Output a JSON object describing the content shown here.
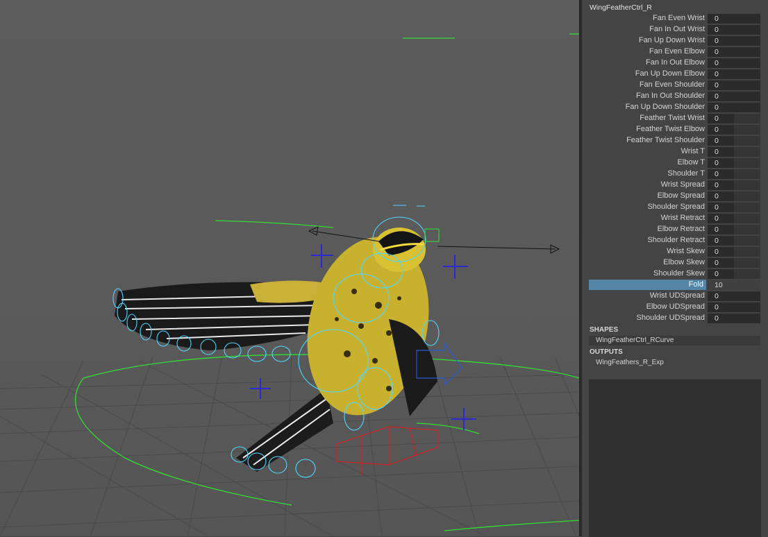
{
  "attribute_editor": {
    "node_name": "WingFeatherCtrl_R",
    "attributes": [
      {
        "label": "Fan Even Wrist",
        "value": "0"
      },
      {
        "label": "Fan In Out Wrist",
        "value": "0"
      },
      {
        "label": "Fan Up Down Wrist",
        "value": "0"
      },
      {
        "label": "Fan Even Elbow",
        "value": "0"
      },
      {
        "label": "Fan In Out Elbow",
        "value": "0"
      },
      {
        "label": "Fan Up Down Elbow",
        "value": "0"
      },
      {
        "label": "Fan Even Shoulder",
        "value": "0"
      },
      {
        "label": "Fan In Out Shoulder",
        "value": "0"
      },
      {
        "label": "Fan Up Down Shoulder",
        "value": "0"
      },
      {
        "label": "Feather Twist Wrist",
        "value": "0"
      },
      {
        "label": "Feather Twist Elbow",
        "value": "0"
      },
      {
        "label": "Feather Twist Shoulder",
        "value": "0"
      },
      {
        "label": "Wrist T",
        "value": "0"
      },
      {
        "label": "Elbow T",
        "value": "0"
      },
      {
        "label": "Shoulder T",
        "value": "0"
      },
      {
        "label": "Wrist Spread",
        "value": "0"
      },
      {
        "label": "Elbow Spread",
        "value": "0"
      },
      {
        "label": "Shoulder Spread",
        "value": "0"
      },
      {
        "label": "Wrist Retract",
        "value": "0"
      },
      {
        "label": "Elbow Retract",
        "value": "0"
      },
      {
        "label": "Shoulder Retract",
        "value": "0"
      },
      {
        "label": "Wrist Skew",
        "value": "0"
      },
      {
        "label": "Elbow Skew",
        "value": "0"
      },
      {
        "label": "Shoulder Skew",
        "value": "0"
      },
      {
        "label": "Fold",
        "value": "10"
      },
      {
        "label": "Wrist UDSpread",
        "value": "0"
      },
      {
        "label": "Elbow UDSpread",
        "value": "0"
      },
      {
        "label": "Shoulder UDSpread",
        "value": "0"
      }
    ],
    "selected_attribute": "Fold",
    "shapes_header": "SHAPES",
    "shapes": [
      "WingFeatherCtrl_RCurve"
    ],
    "outputs_header": "OUTPUTS",
    "outputs": [
      "WingFeathers_R_Exp"
    ]
  },
  "viewport": {
    "subject": "bird-rig",
    "colors": {
      "background": "#5a5a5a",
      "grid": "#4a4a4a",
      "curve_green": "#33dd33",
      "joint_cyan": "#4fd6ff",
      "locator_blue": "#2a2ad0",
      "selection_red": "#cc2222",
      "selected_label_bg": "#5285a6"
    }
  }
}
